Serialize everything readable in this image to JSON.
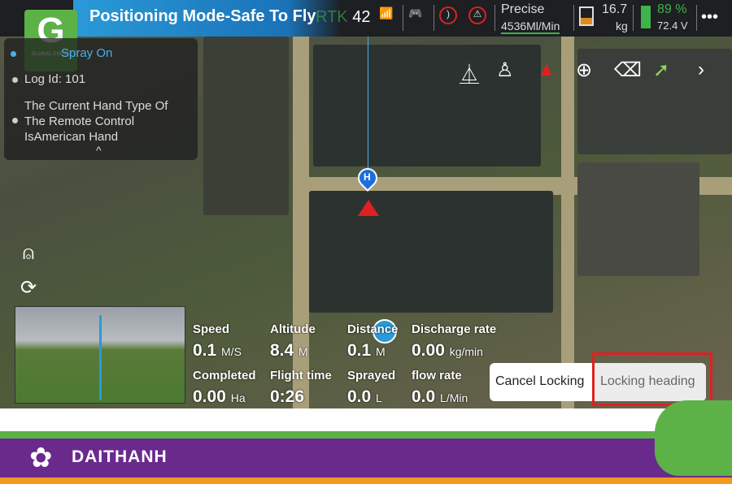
{
  "topbar": {
    "title": "Positioning Mode-Safe To Fly",
    "rtk_label": "RTK",
    "rtk_value": "42",
    "spray_mode": "Precise",
    "flow": "4536Ml/Min",
    "payload": "16.7",
    "payload_unit": "kg",
    "battery_percent": "89 %",
    "battery_voltage": "72.4 V",
    "more": "•••"
  },
  "logo": {
    "text": "GLOBAL CHECK"
  },
  "info": {
    "items": [
      "Spray On",
      "Log Id: 101",
      "The Current Hand Type Of The Remote Control IsAmerican Hand"
    ],
    "collapse": "^"
  },
  "tools": [
    "tripod-icon",
    "person-pin-icon",
    "arrow-north-icon",
    "zoom-in-icon",
    "eraser-icon",
    "route-icon",
    "chevron-right-icon"
  ],
  "map": {
    "home_marker": "H"
  },
  "telemetry": [
    {
      "label": "Speed",
      "value": "0.1",
      "unit": "M/S"
    },
    {
      "label": "Altitude",
      "value": "8.4",
      "unit": "M"
    },
    {
      "label": "Distance",
      "value": "0.1",
      "unit": "M"
    },
    {
      "label": "Discharge rate",
      "value": "0.00",
      "unit": "kg/min"
    },
    {
      "label": "Completed",
      "value": "0.00",
      "unit": "Ha"
    },
    {
      "label": "Flight time",
      "value": "0:26",
      "unit": ""
    },
    {
      "label": "Sprayed",
      "value": "0.0",
      "unit": "L"
    },
    {
      "label": "flow rate",
      "value": "0.0",
      "unit": "L/Min"
    }
  ],
  "buttons": {
    "cancel": "Cancel Locking",
    "lock": "Locking heading"
  },
  "footer": {
    "brand": "DAITHANH"
  },
  "colors": {
    "accent_green": "#5cb247",
    "brand_purple": "#6a2a8c",
    "banner_blue": "#2a9ad8",
    "orange": "#f29a1e",
    "highlight_red": "#e02020"
  }
}
